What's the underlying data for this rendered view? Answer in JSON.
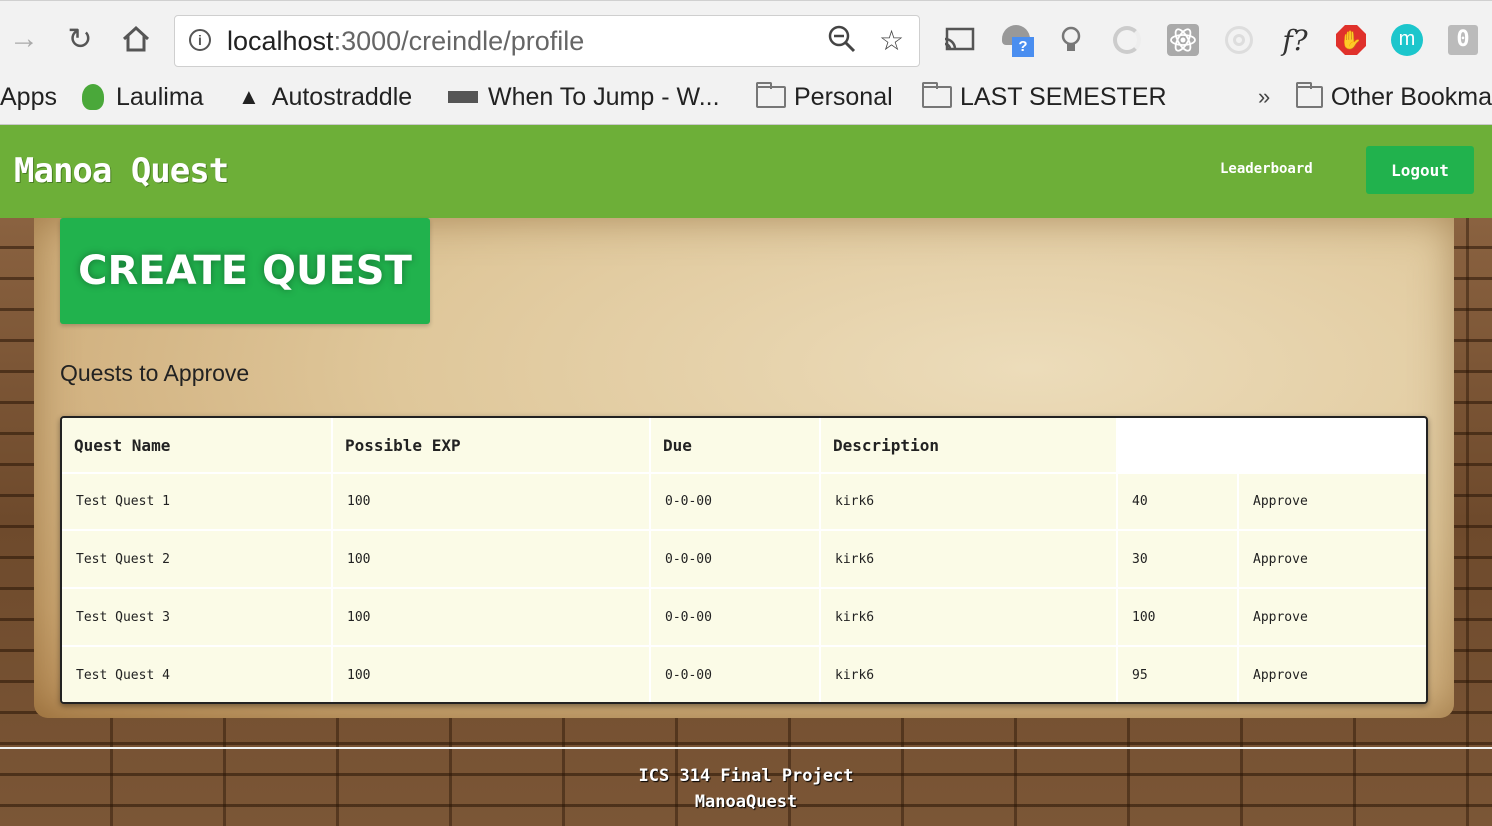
{
  "browser": {
    "url_host": "localhost",
    "url_rest": ":3000/creindle/profile",
    "bookmarks": [
      {
        "label": "Apps",
        "icon": "apps-icon"
      },
      {
        "label": "Laulima",
        "icon": "laulima-icon"
      },
      {
        "label": "Autostraddle",
        "icon": "triangle-icon"
      },
      {
        "label": "When To Jump - W...",
        "icon": "jump-icon"
      },
      {
        "label": "Personal",
        "icon": "folder-icon"
      },
      {
        "label": "LAST SEMESTER",
        "icon": "folder-icon"
      },
      {
        "label": "Other Bookma",
        "icon": "folder-icon"
      }
    ],
    "overflow": "»",
    "extension_glyphs": {
      "fquery": "f?",
      "mendeley": "m",
      "help_badge": "?",
      "counter": "0"
    }
  },
  "header": {
    "brand": "Manoa Quest",
    "leaderboard": "Leaderboard",
    "logout": "Logout"
  },
  "main": {
    "create_button": "CREATE QUEST",
    "section_title": "Quests to Approve",
    "table": {
      "columns": [
        "Quest Name",
        "Possible EXP",
        "Due",
        "Description"
      ],
      "rows": [
        {
          "name": "Test Quest 1",
          "exp": "100",
          "due": "0-0-00",
          "description": "kirk6",
          "extra": "40",
          "action": "Approve"
        },
        {
          "name": "Test Quest 2",
          "exp": "100",
          "due": "0-0-00",
          "description": "kirk6",
          "extra": "30",
          "action": "Approve"
        },
        {
          "name": "Test Quest 3",
          "exp": "100",
          "due": "0-0-00",
          "description": "kirk6",
          "extra": "100",
          "action": "Approve"
        },
        {
          "name": "Test Quest 4",
          "exp": "100",
          "due": "0-0-00",
          "description": "kirk6",
          "extra": "95",
          "action": "Approve"
        }
      ]
    }
  },
  "footer": {
    "line1": "ICS 314 Final Project",
    "line2": "ManoaQuest"
  },
  "colors": {
    "nav_green": "#6daf38",
    "button_green": "#21b24d",
    "cell_bg": "#fbfbe7"
  }
}
